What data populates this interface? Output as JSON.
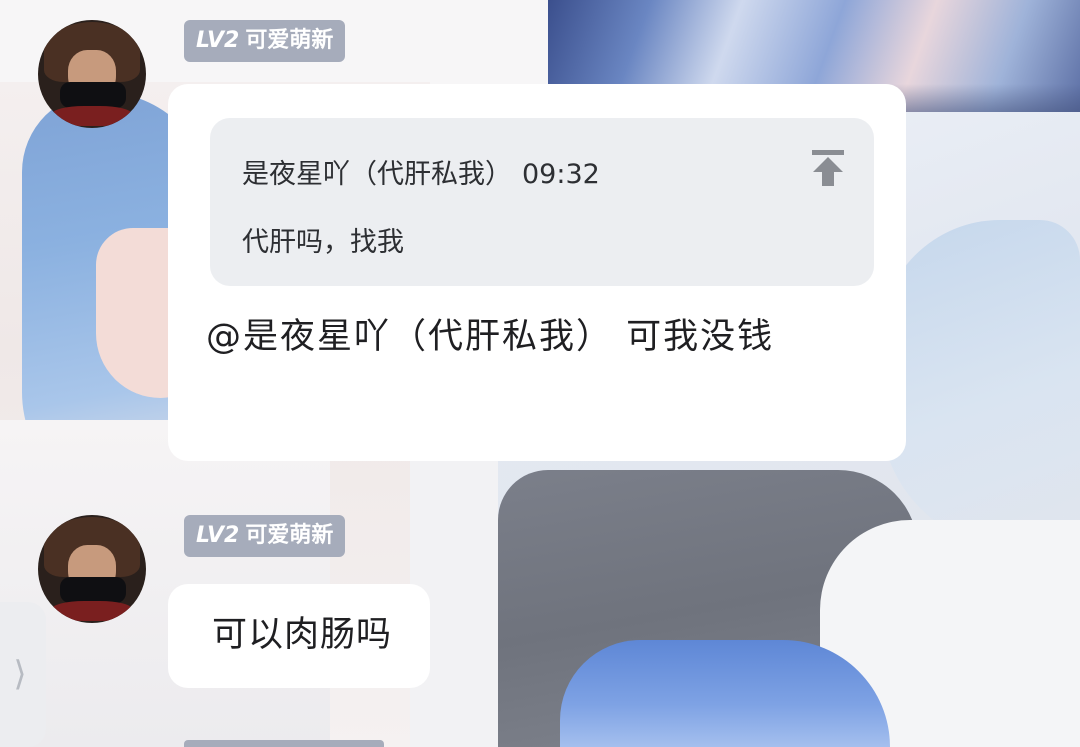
{
  "messages": [
    {
      "sender_badge": {
        "level": "LV2",
        "title": "可爱萌新"
      },
      "quote": {
        "sender": "是夜星吖（代肝私我）",
        "time": "09:32",
        "text": "代肝吗，找我",
        "icon": "pin-to-top-icon"
      },
      "text": "@是夜星吖（代肝私我） 可我没钱"
    },
    {
      "sender_badge": {
        "level": "LV2",
        "title": "可爱萌新"
      },
      "text": "可以肉肠吗"
    }
  ],
  "side_handle": {
    "label": "⟩"
  },
  "colors": {
    "badge_bg": "#a6acbb",
    "bubble_bg": "#ffffff",
    "quote_bg": "#eceef1",
    "text": "#1f1f22"
  }
}
